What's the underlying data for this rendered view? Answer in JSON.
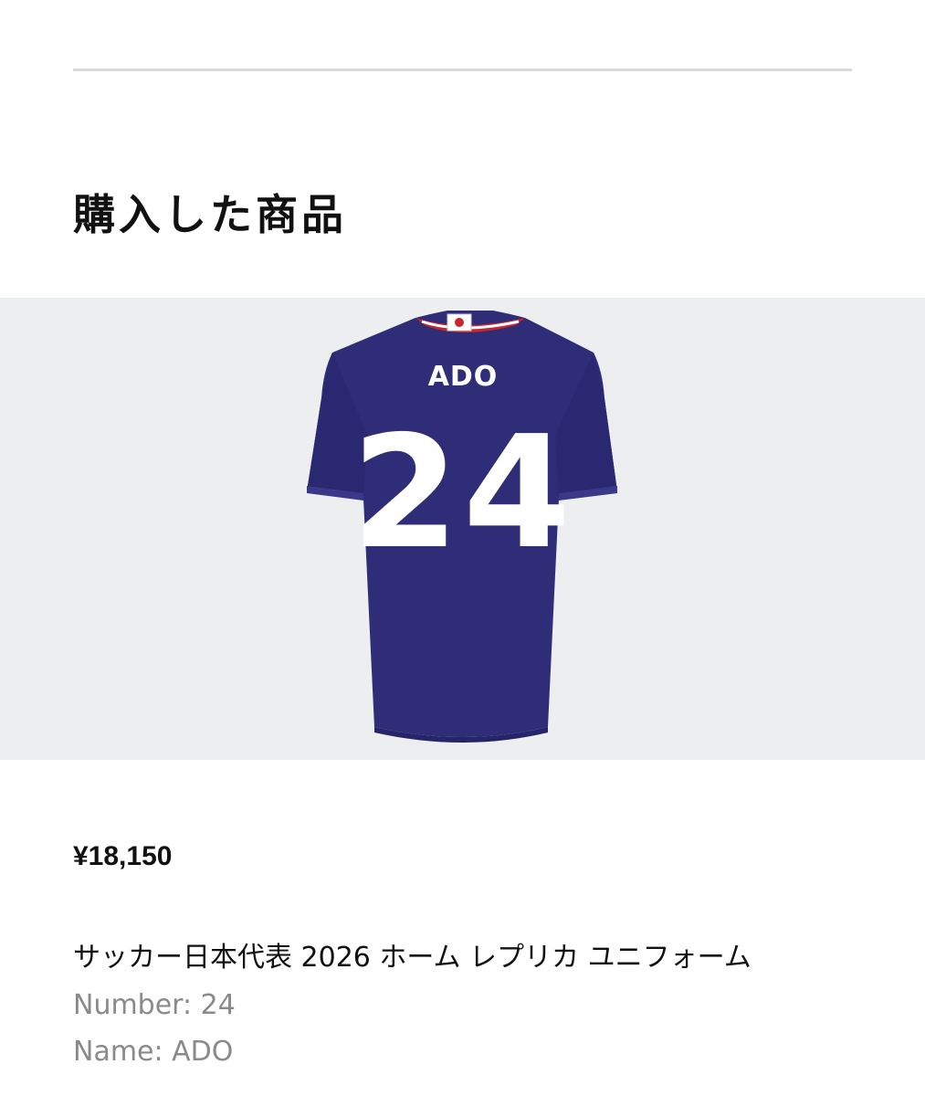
{
  "section": {
    "title": "購入した商品"
  },
  "product": {
    "image_alt": "サッカー日本代表 2026 ホーム レプリカ ユニフォーム",
    "jersey_name": "ADO",
    "jersey_number": "24",
    "price": "¥18,150",
    "name": "サッカー日本代表 2026 ホーム レプリカ ユニフォーム",
    "specs": {
      "number_label": "Number: 24",
      "name_label": "Name: ADO"
    }
  },
  "colors": {
    "jersey": "#2f2d77",
    "image_bg": "#eceef0",
    "collar_red": "#c8262e",
    "print": "#ffffff"
  }
}
